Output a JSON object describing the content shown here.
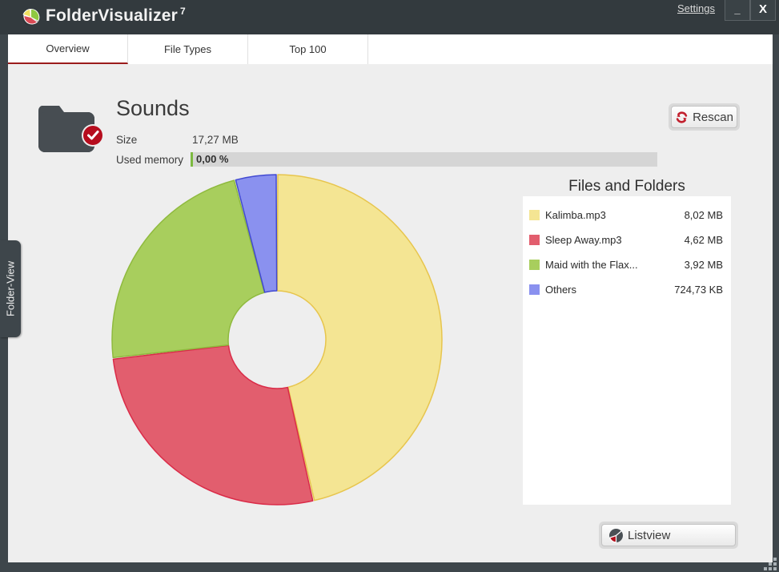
{
  "window": {
    "title": "FolderVisualizer",
    "version_superscript": "7",
    "settings_label": "Settings",
    "minimize_label": "_",
    "close_label": "X"
  },
  "tabs": [
    {
      "label": "Overview",
      "active": true
    },
    {
      "label": "File Types",
      "active": false
    },
    {
      "label": "Top 100",
      "active": false
    }
  ],
  "side_tab": {
    "label": "Folder-View"
  },
  "overview": {
    "folder_name": "Sounds",
    "size_label": "Size",
    "size_value": "17,27 MB",
    "used_memory_label": "Used memory",
    "used_memory_value": "0,00 %",
    "used_memory_percent": 0,
    "rescan_label": "Rescan",
    "listview_label": "Listview"
  },
  "chart_data": {
    "type": "donut",
    "title": "Files and Folders",
    "unit": "MB",
    "total_mb": 17.27,
    "total_label": "17,27 MB",
    "start_angle_deg": -90,
    "direction": "clockwise",
    "inner_radius_ratio": 0.29,
    "legend_position": "right",
    "series": [
      {
        "name": "Kalimba.mp3",
        "value_mb": 8.02,
        "size_label": "8,02 MB",
        "color": "#f4e593",
        "stroke": "#e7c54d"
      },
      {
        "name": "Sleep Away.mp3",
        "value_mb": 4.62,
        "size_label": "4,62 MB",
        "color": "#e25e6e",
        "stroke": "#da2b48"
      },
      {
        "name": "Maid with the Flax...",
        "value_mb": 3.92,
        "size_label": "3,92 MB",
        "color": "#a8ce5d",
        "stroke": "#8fba3e"
      },
      {
        "name": "Others",
        "value_mb": 0.71,
        "size_label": "724,73 KB",
        "color": "#8a91ef",
        "stroke": "#4149d1"
      }
    ]
  },
  "colors": {
    "accent_red": "#9b1c1c",
    "titlebar": "#333a3e",
    "frame": "#3e464b",
    "content_bg": "#eeeeee",
    "memory_green": "#7cb940"
  }
}
